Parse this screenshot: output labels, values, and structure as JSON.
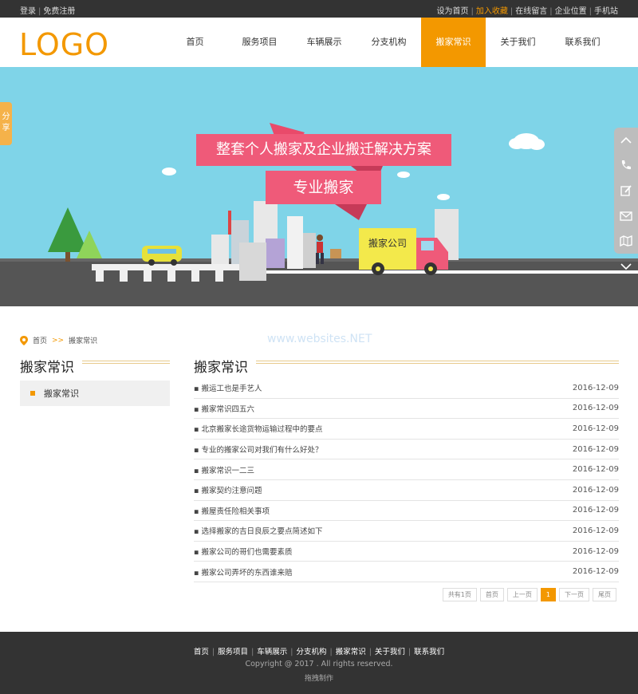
{
  "topbar": {
    "login": "登录",
    "register": "免费注册",
    "right_links": [
      "设为首页",
      "加入收藏",
      "在线留言",
      "企业位置",
      "手机站"
    ]
  },
  "header": {
    "logo": "LOGO",
    "nav": [
      "首页",
      "服务项目",
      "车辆展示",
      "分支机构",
      "搬家常识",
      "关于我们",
      "联系我们"
    ],
    "active_index": 4
  },
  "banner": {
    "headline": "整套个人搬家及企业搬迁解决方案",
    "subheadline": "专业搬家",
    "truck_label": "搬家公司"
  },
  "share_tab": "分享",
  "breadcrumb": {
    "home": "首页",
    "separator": ">>",
    "current": "搬家常识"
  },
  "watermark": "www.websites.NET",
  "sidebar": {
    "title": "搬家常识",
    "items": [
      "搬家常识"
    ]
  },
  "main": {
    "title": "搬家常识",
    "articles": [
      {
        "title": "▪ 搬运工也是手艺人",
        "date": "2016-12-09"
      },
      {
        "title": "▪ 搬家常识四五六",
        "date": "2016-12-09"
      },
      {
        "title": "▪ 北京搬家长途货物运输过程中的要点",
        "date": "2016-12-09"
      },
      {
        "title": "▪ 专业的搬家公司对我们有什么好处？",
        "date": "2016-12-09"
      },
      {
        "title": "▪ 搬家常识一二三",
        "date": "2016-12-09"
      },
      {
        "title": "▪ 搬家契约注意问题",
        "date": "2016-12-09"
      },
      {
        "title": "▪ 搬屋责任险相关事项",
        "date": "2016-12-09"
      },
      {
        "title": "▪ 选择搬家的吉日良辰之要点简述如下",
        "date": "2016-12-09"
      },
      {
        "title": "▪ 搬家公司的哥们也需要素质",
        "date": "2016-12-09"
      },
      {
        "title": "▪ 搬家公司弄坏的东西谁来赔",
        "date": "2016-12-09"
      }
    ]
  },
  "pager": {
    "total": "共有1页",
    "first": "首页",
    "prev": "上一页",
    "current": "1",
    "next": "下一页",
    "last": "尾页"
  },
  "footer": {
    "links": [
      "首页",
      "服务项目",
      "车辆展示",
      "分支机构",
      "搬家常识",
      "关于我们",
      "联系我们"
    ],
    "copyright": "Copyright @ 2017 . All rights reserved.",
    "made_by": "拖拽制作"
  },
  "colors": {
    "accent": "#f39800",
    "sky": "#7fd4e8",
    "ribbon": "#ef5a79",
    "footer_bg": "#333333"
  }
}
